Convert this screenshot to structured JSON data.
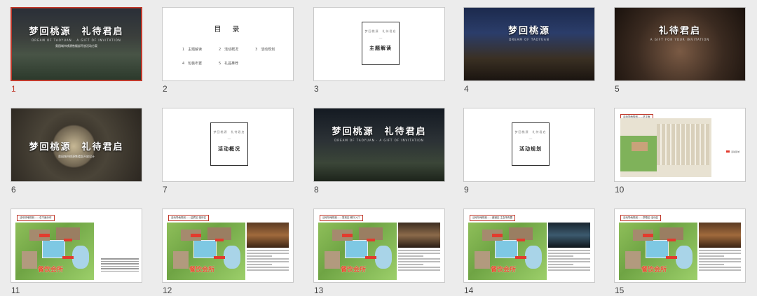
{
  "app": "presentation-slide-sorter",
  "selected_slide": 1,
  "slides": [
    {
      "num": "1",
      "type": "title",
      "title": "梦回桃源　礼待君启",
      "sub": "DREAM OF TAOYUAN · A GIFT OF INVITATION",
      "line": "奥园城市桃源售楼部开放活动方案"
    },
    {
      "num": "2",
      "type": "toc",
      "title": "目　录",
      "items": [
        "1　主题解读",
        "2　活动概况",
        "3　活动规划",
        "4　包装布置",
        "5　礼品推荐"
      ]
    },
    {
      "num": "3",
      "type": "section",
      "top": "梦回桃源　礼待君启",
      "title": "主题解读"
    },
    {
      "num": "4",
      "type": "night",
      "title": "梦回桃源",
      "sub": "DREAM OF TAOYUAN"
    },
    {
      "num": "5",
      "type": "hand",
      "title": "礼待君启",
      "sub": "A GIFT FOR YOUR INVITATION"
    },
    {
      "num": "6",
      "type": "moon",
      "title": "梦回桃源　礼待君启",
      "line": "奥园城市桃源售楼部开放设计"
    },
    {
      "num": "7",
      "type": "section",
      "top": "梦回桃源　礼待君启",
      "title": "活动概况"
    },
    {
      "num": "8",
      "type": "courtyard",
      "title": "梦回桃源　礼待君启",
      "sub": "DREAM OF TAOYUAN · A GIFT OF INVITATION"
    },
    {
      "num": "9",
      "type": "section",
      "top": "梦回桃源　礼待君启",
      "title": "活动规划"
    },
    {
      "num": "10",
      "type": "plan",
      "tag": "活动场地规划——总平面",
      "legend": "活动区域"
    },
    {
      "num": "11",
      "type": "map",
      "tag": "活动场地规划——总平面分布",
      "label": "餐饮会所",
      "photo": "none"
    },
    {
      "num": "12",
      "type": "map",
      "tag": "活动场地规划——迎宾区·接待区",
      "label": "餐饮会所",
      "photo": "wood"
    },
    {
      "num": "13",
      "type": "map",
      "tag": "活动场地规划——签到区·餐厅入口",
      "label": "餐饮会所",
      "photo": "lounge"
    },
    {
      "num": "14",
      "type": "map",
      "tag": "活动场地规划——廊道区·主会场布置",
      "label": "餐饮会所",
      "photo": "glass"
    },
    {
      "num": "15",
      "type": "map",
      "tag": "活动场地规划——茶歇区·活动区",
      "label": "餐饮会所",
      "photo": "wood"
    }
  ]
}
